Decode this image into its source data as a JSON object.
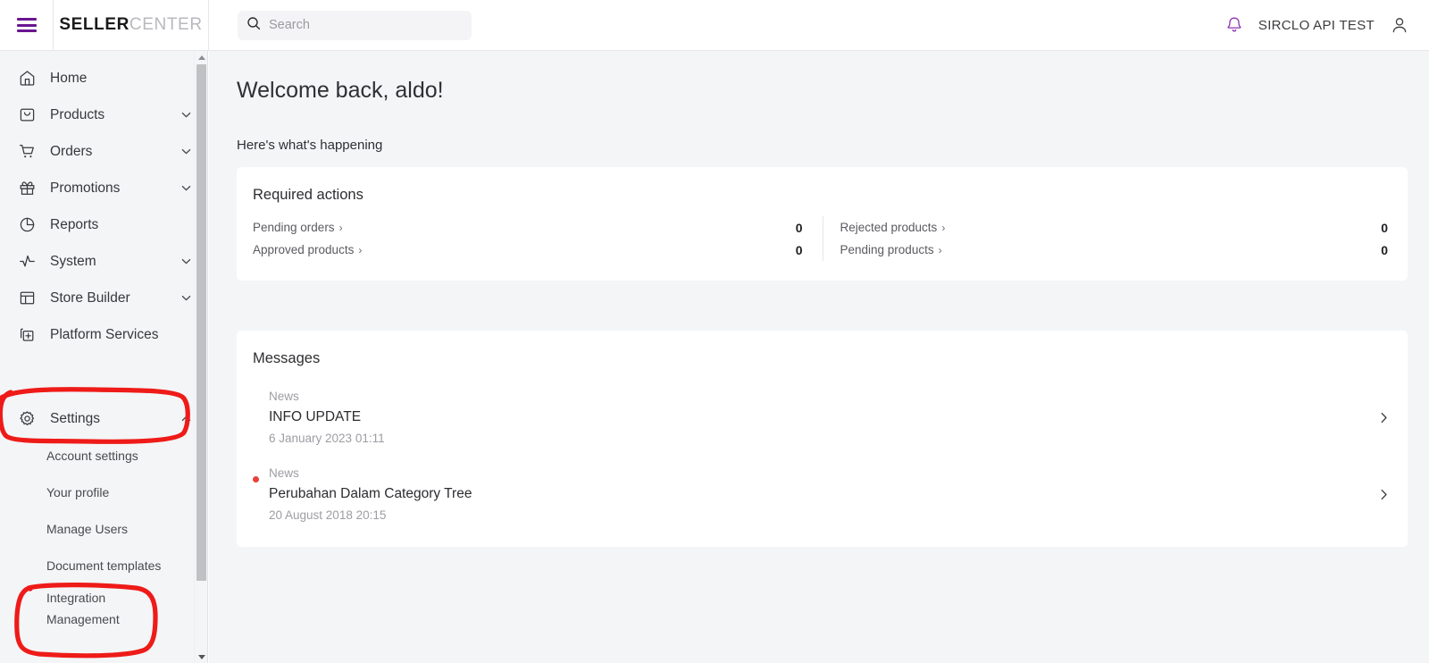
{
  "topbar": {
    "menu_icon": "hamburger-menu-icon",
    "logo_bold": "SELLER",
    "logo_light": "CENTER",
    "search": {
      "placeholder": "Search",
      "value": "",
      "icon": "search-icon"
    },
    "notification_icon": "bell-icon",
    "account_name": "SIRCLO API TEST",
    "avatar_icon": "user-icon"
  },
  "sidebar": {
    "items": [
      {
        "label": "Home",
        "icon": "home-icon",
        "expandable": false
      },
      {
        "label": "Products",
        "icon": "bag-icon",
        "expandable": true,
        "expanded": false
      },
      {
        "label": "Orders",
        "icon": "cart-icon",
        "expandable": true,
        "expanded": false
      },
      {
        "label": "Promotions",
        "icon": "gift-icon",
        "expandable": true,
        "expanded": false
      },
      {
        "label": "Reports",
        "icon": "pie-chart-icon",
        "expandable": false
      },
      {
        "label": "System",
        "icon": "activity-icon",
        "expandable": true,
        "expanded": false
      },
      {
        "label": "Store Builder",
        "icon": "layout-icon",
        "expandable": true,
        "expanded": false
      },
      {
        "label": "Platform Services",
        "icon": "add-module-icon",
        "expandable": false
      },
      {
        "label": "Settings",
        "icon": "gear-icon",
        "expandable": true,
        "expanded": true
      }
    ],
    "settings_children": [
      {
        "label": "Account settings"
      },
      {
        "label": "Your profile"
      },
      {
        "label": "Manage Users"
      },
      {
        "label": "Document templates"
      },
      {
        "label": "Integration",
        "label2": "Management"
      }
    ],
    "scrollbar": {
      "up_icon": "scroll-up-arrow-icon",
      "down_icon": "scroll-down-arrow-icon"
    }
  },
  "main": {
    "welcome": "Welcome back, aldo!",
    "subtitle": "Here's what's happening",
    "required_actions": {
      "title": "Required actions",
      "left": [
        {
          "label": "Pending orders",
          "chevron": "›",
          "value": "0"
        },
        {
          "label": "Approved products",
          "chevron": "›",
          "value": "0"
        }
      ],
      "right": [
        {
          "label": "Rejected products",
          "chevron": "›",
          "value": "0"
        },
        {
          "label": "Pending products",
          "chevron": "›",
          "value": "0"
        }
      ]
    },
    "messages": {
      "title": "Messages",
      "items": [
        {
          "kind": "News",
          "subject": "INFO UPDATE",
          "date": "6 January 2023 01:11",
          "unread": false
        },
        {
          "kind": "News",
          "subject": "Perubahan Dalam Category Tree",
          "date": "20 August 2018 20:15",
          "unread": true
        }
      ]
    }
  },
  "annotations": {
    "color": "#ee1b18",
    "shapes": [
      {
        "name": "settings-highlight-circle"
      },
      {
        "name": "integration-management-highlight-circle"
      }
    ]
  },
  "colors": {
    "brand_purple": "#6a1590",
    "page_bg": "#f4f5f7",
    "card_bg": "#ffffff",
    "unread_dot": "#e8423a",
    "annotation_red": "#ee1b18"
  }
}
